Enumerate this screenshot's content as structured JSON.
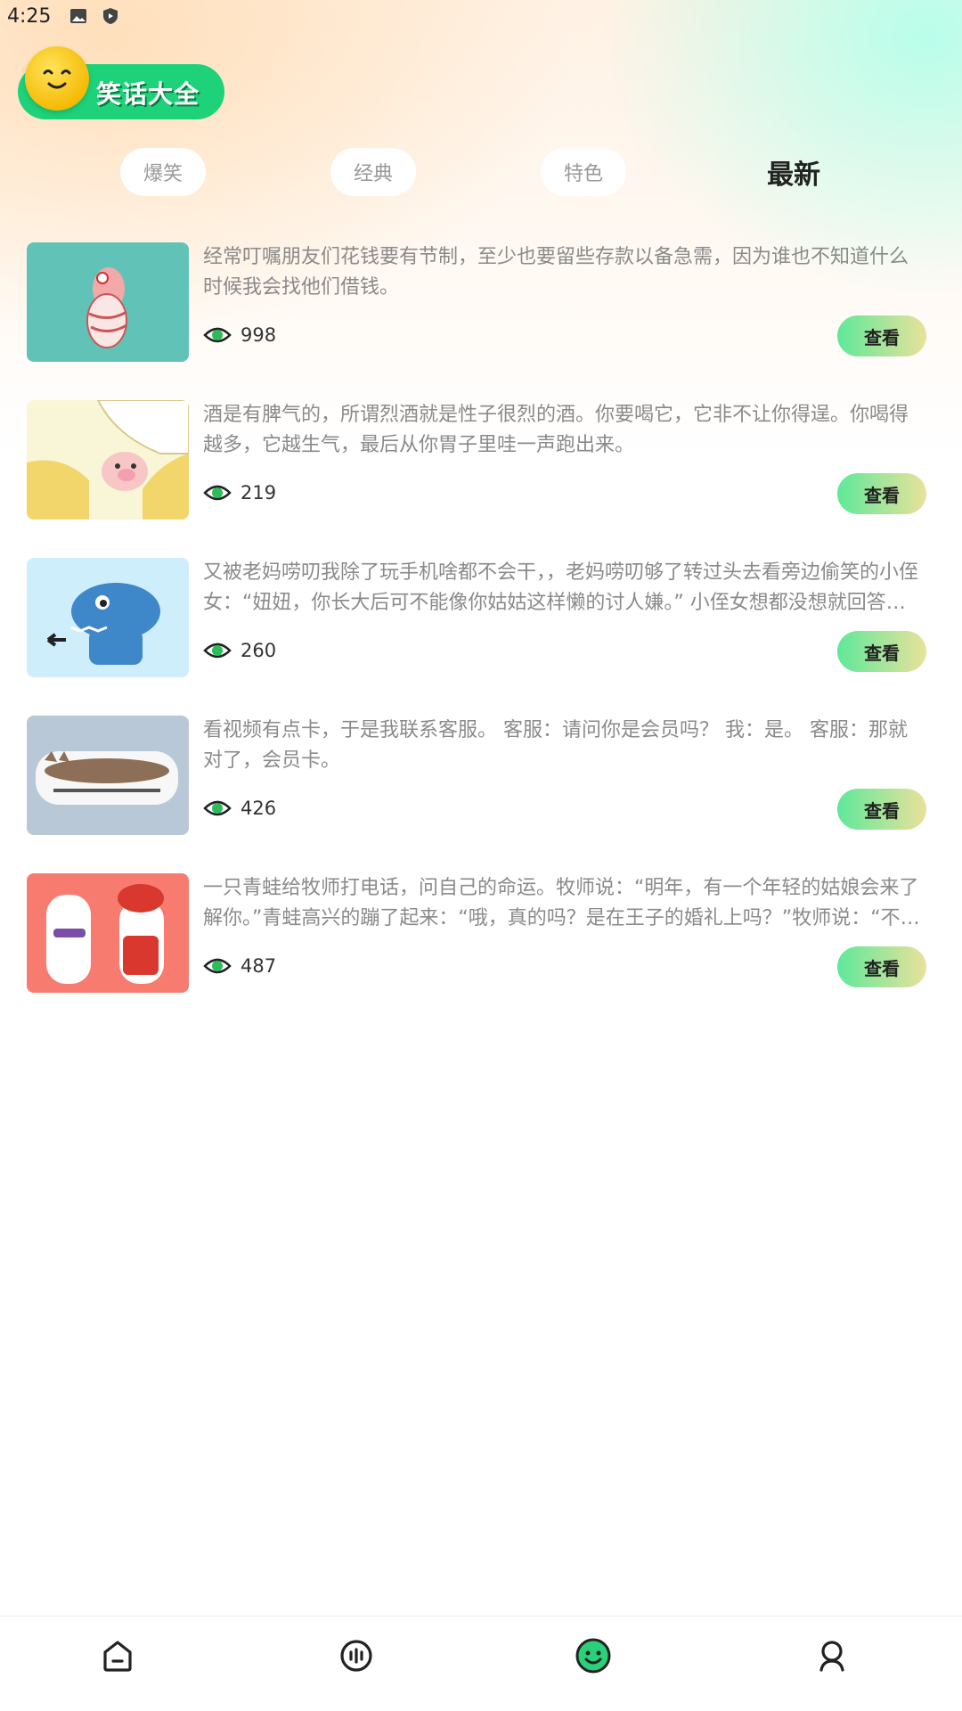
{
  "status_bar": {
    "time": "4:25"
  },
  "app": {
    "title": "笑话大全"
  },
  "tabs": [
    {
      "label": "爆笑",
      "active": false
    },
    {
      "label": "经典",
      "active": false
    },
    {
      "label": "特色",
      "active": false
    },
    {
      "label": "最新",
      "active": true
    }
  ],
  "items": [
    {
      "text": "经常叮嘱朋友们花钱要有节制，至少也要留些存款以备急需，因为谁也不知道什么时候我会找他们借钱。",
      "views": "998",
      "button": "查看",
      "thumb_bg": "#61c3b8"
    },
    {
      "text": "酒是有脾气的，所谓烈酒就是性子很烈的酒。你要喝它，它非不让你得逞。你喝得越多，它越生气，最后从你胃子里哇一声跑出来。",
      "views": "219",
      "button": "查看",
      "thumb_bg": "#f8f6d6"
    },
    {
      "text": "又被老妈唠叨我除了玩手机啥都不会干，，老妈唠叨够了转过头去看旁边偷笑的小侄女：“妞妞，你长大后可不能像你姑姑这样懒的讨人嫌。” 小侄女想都没想就回答说：“奶奶放心，我长大后才不会像姑姑一样呢！”",
      "views": "260",
      "button": "查看",
      "thumb_bg": "#cfeefb"
    },
    {
      "text": "看视频有点卡，于是我联系客服。 客服：请问你是会员吗？ 我：是。 客服：那就对了，会员卡。",
      "views": "426",
      "button": "查看",
      "thumb_bg": "#b8c8d6"
    },
    {
      "text": "一只青蛙给牧师打电话，问自己的命运。牧师说：“明年，有一个年轻的姑娘会来了解你。”青蛙高兴的蹦了起来：“哦，真的吗？是在王子的婚礼上吗？”牧师说：“不，是在明年的生物课上。”",
      "views": "487",
      "button": "查看",
      "thumb_bg": "#f77b6f"
    }
  ],
  "nav": [
    {
      "name": "home-icon"
    },
    {
      "name": "audio-icon"
    },
    {
      "name": "smile-icon",
      "active": true
    },
    {
      "name": "profile-icon"
    }
  ],
  "colors": {
    "accent": "#1ed27a",
    "eye": "#2dbb5c"
  }
}
